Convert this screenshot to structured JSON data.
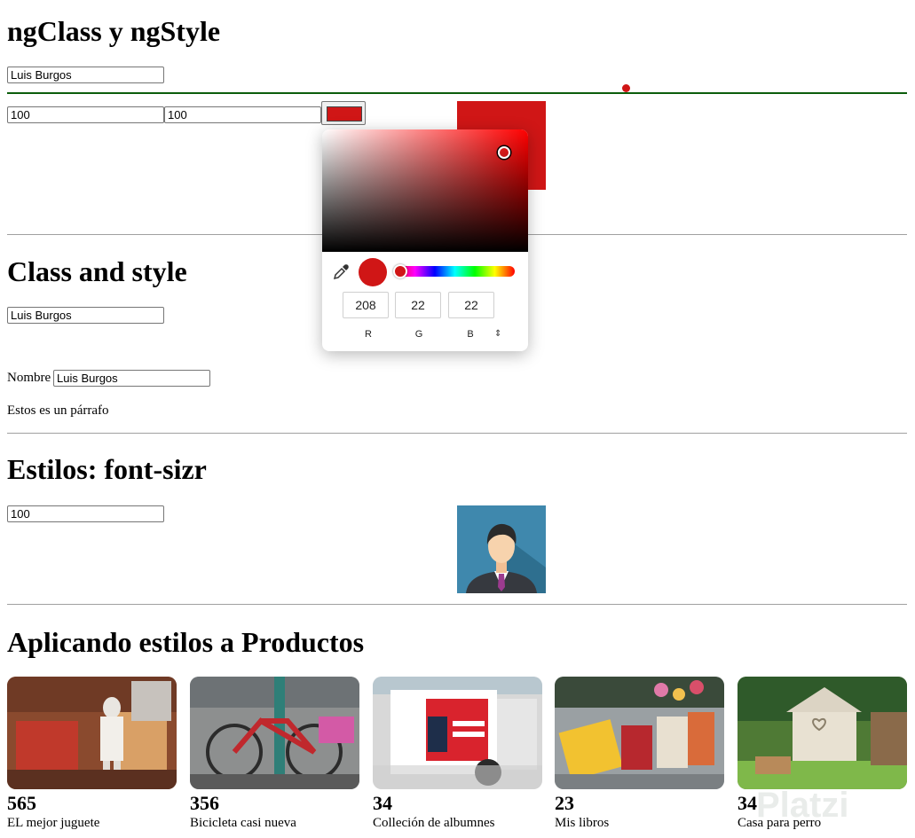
{
  "section1": {
    "title": "ngClass y ngStyle",
    "name_value": "Luis Burgos",
    "width_value": "100",
    "height_value": "100"
  },
  "color_picker": {
    "color": "#d01616",
    "r": "208",
    "g": "22",
    "b": "22",
    "label_r": "R",
    "label_g": "G",
    "label_b": "B"
  },
  "section2": {
    "title": "Class and style",
    "name_value": "Luis Burgos",
    "nombre_label": "Nombre",
    "nombre_value": "Luis Burgos",
    "paragraph": "Estos es un párrafo"
  },
  "section3": {
    "title": "Estilos: font-sizr",
    "size_value": "100"
  },
  "section4": {
    "title": "Aplicando estilos a Productos",
    "products": [
      {
        "price": "565",
        "title": "EL mejor juguete"
      },
      {
        "price": "356",
        "title": "Bicicleta casi nueva"
      },
      {
        "price": "34",
        "title": "Colleción de albumnes"
      },
      {
        "price": "23",
        "title": "Mis libros"
      },
      {
        "price": "34",
        "title": "Casa para perro"
      }
    ]
  },
  "watermark": "Platzi"
}
